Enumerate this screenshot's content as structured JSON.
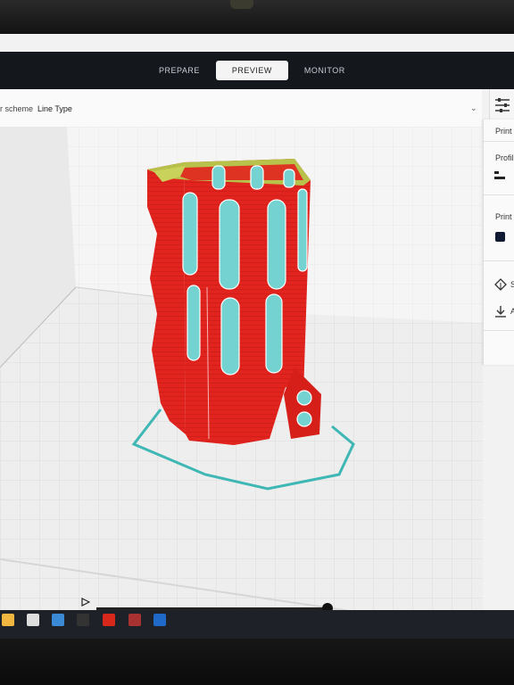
{
  "header": {
    "tabs": [
      {
        "label": "PREPARE",
        "active": false
      },
      {
        "label": "PREVIEW",
        "active": true
      },
      {
        "label": "MONITOR",
        "active": false
      }
    ]
  },
  "toolbar": {
    "scheme_label": "r scheme",
    "scheme_value": "Line Type"
  },
  "print_panel": {
    "title": "Print",
    "profile_label": "Profil",
    "print_setup_label": "Print s",
    "slice_label": "S",
    "save_label": "A"
  },
  "icons": {
    "settings": "settings-sliders-icon",
    "chevron": "chevron-down-icon",
    "play": "play-icon",
    "support": "support-icon",
    "download": "download-icon"
  },
  "colors": {
    "wall": "#e2241f",
    "infill": "#b8c24a",
    "skirt": "#3fb7b4",
    "window": "#74d3d0",
    "header": "#14171c"
  }
}
